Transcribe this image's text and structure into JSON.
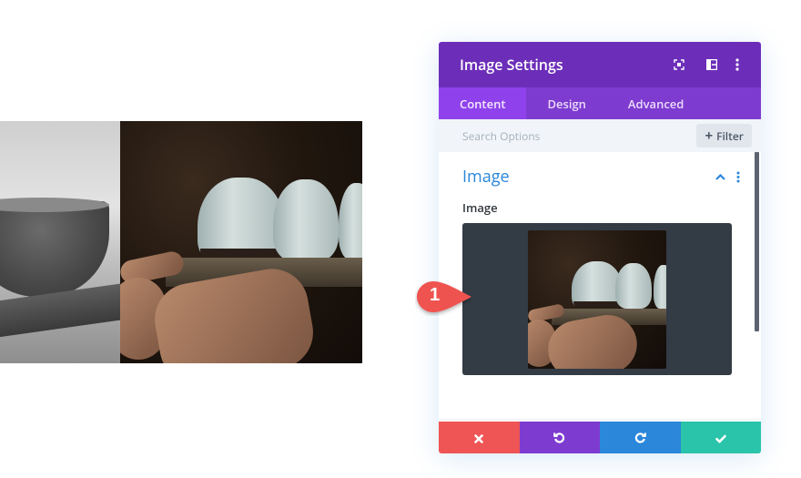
{
  "preview": {
    "images": [
      {
        "name": "black-and-white-bowl-photo",
        "description": "grayscale ceramic bowl on a wooden board"
      },
      {
        "name": "pottery-hands-photo",
        "description": "hands holding ceramic vases on a slab"
      }
    ]
  },
  "panel": {
    "title": "Image Settings",
    "header_icons": [
      "expand-icon",
      "split-view-icon",
      "more-options-icon"
    ],
    "tabs": [
      {
        "label": "Content",
        "active": true
      },
      {
        "label": "Design",
        "active": false
      },
      {
        "label": "Advanced",
        "active": false
      }
    ],
    "search": {
      "placeholder": "Search Options",
      "value": ""
    },
    "filter_button": {
      "icon": "+",
      "label": "Filter"
    },
    "group": {
      "title": "Image",
      "expanded": true,
      "field": {
        "label": "Image",
        "value": "pottery-hands-photo"
      }
    },
    "actions": [
      {
        "name": "discard",
        "icon": "close-icon",
        "color": "#ef5555"
      },
      {
        "name": "undo",
        "icon": "undo-icon",
        "color": "#7e3bd0"
      },
      {
        "name": "redo",
        "icon": "redo-icon",
        "color": "#2b87da"
      },
      {
        "name": "save",
        "icon": "check-icon",
        "color": "#29c4a9"
      }
    ],
    "colors": {
      "header": "#6c2eb9",
      "tabs": "#7d3bcf",
      "active_tab": "#8f42ec",
      "group_title": "#2b87da",
      "upload_bg": "#333b45"
    }
  },
  "step_badge": {
    "label": "1",
    "color": "#ef5350"
  }
}
